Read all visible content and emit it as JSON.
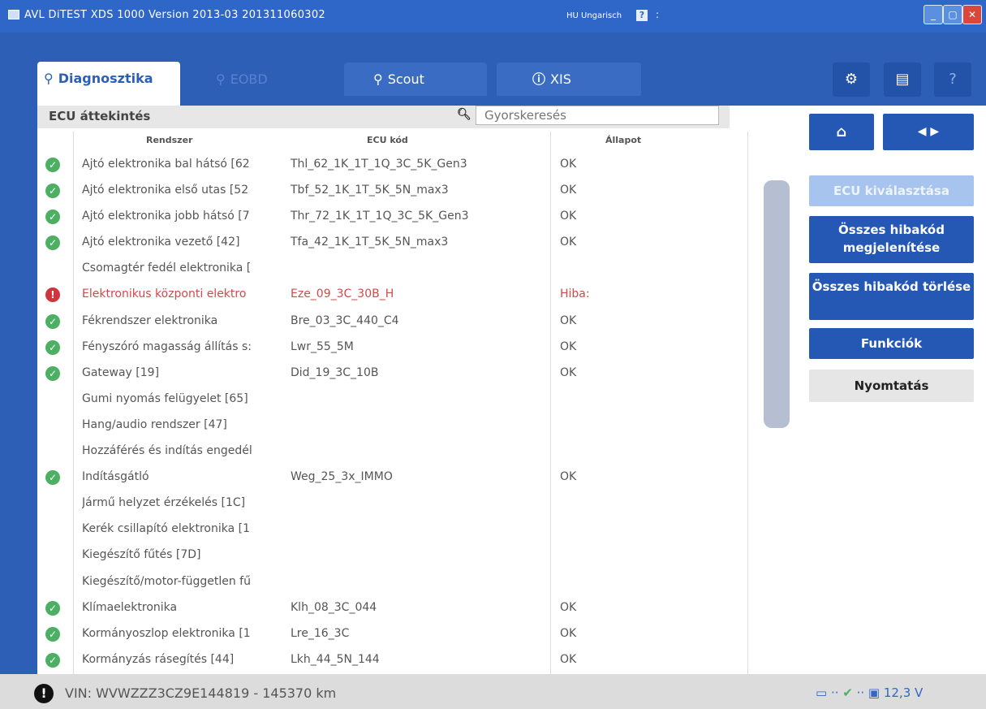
{
  "window": {
    "title": "AVL DiTEST XDS 1000 Version 2013-03  201311060302",
    "language": "HU Ungarisch",
    "help_badge": "?",
    "dots": ":",
    "controls": [
      "_",
      "▢",
      "✕"
    ]
  },
  "tabs": [
    {
      "label": "Diagnosztika",
      "icon": "car-search-icon",
      "active": true
    },
    {
      "label": "EOBD",
      "icon": "engine-search-icon",
      "active": false
    },
    {
      "label": "Scout",
      "icon": "car-search-icon",
      "active": false
    },
    {
      "label": "XIS",
      "icon": "car-info-icon",
      "active": false
    }
  ],
  "top_buttons": {
    "settings": "⚙",
    "chat": "▤",
    "help": "?"
  },
  "ecu_overview": {
    "title": "ECU áttekintés",
    "search_placeholder": "Gyorskeresés",
    "columns": [
      "Rendszer",
      "ECU kód",
      "Állapot"
    ],
    "rows": [
      {
        "status": "ok",
        "system": "Ajtó elektronika bal hátsó [62",
        "code": "Thl_62_1K_1T_1Q_3C_5K_Gen3",
        "state": "OK"
      },
      {
        "status": "ok",
        "system": "Ajtó elektronika első utas [52",
        "code": "Tbf_52_1K_1T_5K_5N_max3",
        "state": "OK"
      },
      {
        "status": "ok",
        "system": "Ajtó elektronika jobb hátsó [7",
        "code": "Thr_72_1K_1T_1Q_3C_5K_Gen3",
        "state": "OK"
      },
      {
        "status": "ok",
        "system": "Ajtó elektronika vezető [42]",
        "code": "Tfa_42_1K_1T_5K_5N_max3",
        "state": "OK"
      },
      {
        "status": "none",
        "system": "Csomagtér fedél elektronika [",
        "code": "",
        "state": ""
      },
      {
        "status": "error",
        "system": "Elektronikus központi elektro",
        "code": "Eze_09_3C_30B_H",
        "state": "Hiba:"
      },
      {
        "status": "ok",
        "system": "Fékrendszer elektronika",
        "code": "Bre_03_3C_440_C4",
        "state": "OK"
      },
      {
        "status": "ok",
        "system": "Fényszóró magasság állítás s:",
        "code": "Lwr_55_5M",
        "state": "OK"
      },
      {
        "status": "ok",
        "system": "Gateway [19]",
        "code": "Did_19_3C_10B",
        "state": "OK"
      },
      {
        "status": "none",
        "system": "Gumi nyomás felügyelet [65]",
        "code": "",
        "state": ""
      },
      {
        "status": "none",
        "system": "Hang/audio rendszer [47]",
        "code": "",
        "state": ""
      },
      {
        "status": "none",
        "system": "Hozzáférés és indítás engedél",
        "code": "",
        "state": ""
      },
      {
        "status": "ok",
        "system": "Indításgátló",
        "code": "Weg_25_3x_IMMO",
        "state": "OK"
      },
      {
        "status": "none",
        "system": "Jármű helyzet érzékelés [1C]",
        "code": "",
        "state": ""
      },
      {
        "status": "none",
        "system": "Kerék csillapító elektronika [1",
        "code": "",
        "state": ""
      },
      {
        "status": "none",
        "system": "Kiegészítő fűtés [7D]",
        "code": "",
        "state": ""
      },
      {
        "status": "none",
        "system": "Kiegészítő/motor-független fű",
        "code": "",
        "state": ""
      },
      {
        "status": "ok",
        "system": "Klímaelektronika",
        "code": "Klh_08_3C_044",
        "state": "OK"
      },
      {
        "status": "ok",
        "system": "Kormányoszlop elektronika [1",
        "code": "Lre_16_3C",
        "state": "OK"
      },
      {
        "status": "ok",
        "system": "Kormányzás rásegítés [44]",
        "code": "Lkh_44_5N_144",
        "state": "OK"
      }
    ]
  },
  "side_buttons": {
    "home": "⌂",
    "nav": "◀          ▶",
    "ecu_select": "ECU kiválasztása",
    "show_all": "Összes hibakód megjelenítése",
    "delete_all": "Összes hibakód törlése",
    "functions": "Funkciók",
    "print": "Nyomtatás"
  },
  "statusbar": {
    "vin": "VIN: WVWZZZ3CZ9E144819 - 145370 km",
    "voltage": "12,3 V",
    "icon_error": "!",
    "connection_icons": "▭ ·· ",
    "check": "✔",
    "conn_tail": " ·· ▣ "
  },
  "colors": {
    "accent": "#2e5fb7",
    "ok": "#4caf63",
    "error": "#d0353d"
  }
}
